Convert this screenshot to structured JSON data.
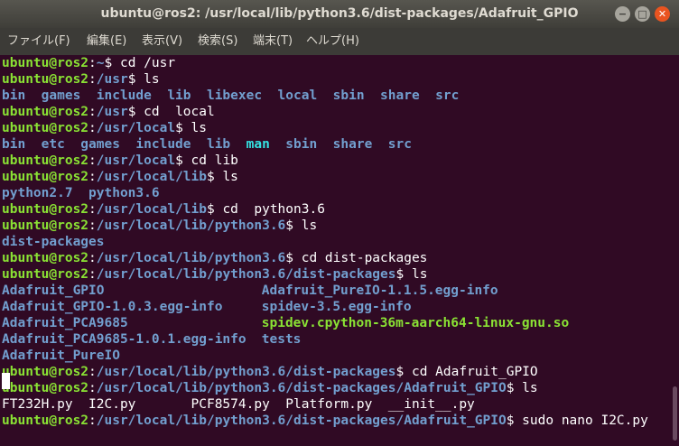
{
  "window": {
    "title": "ubuntu@ros2: /usr/local/lib/python3.6/dist-packages/Adafruit_GPIO",
    "minimize_glyph": "−",
    "maximize_glyph": "□",
    "close_glyph": "✕"
  },
  "menu": [
    "ファイル(F)",
    "編集(E)",
    "表示(V)",
    "検索(S)",
    "端末(T)",
    "ヘルプ(H)"
  ],
  "colors": {
    "background": "#300a24",
    "user_host": "#8ae234",
    "path": "#729fcf",
    "directory": "#729fcf",
    "symlink": "#34e2e2",
    "text": "#ffffff"
  },
  "terminal": {
    "lines": [
      {
        "segs": [
          {
            "t": "ubuntu@ros2",
            "c": "u"
          },
          {
            "t": ":",
            "c": "t"
          },
          {
            "t": "~",
            "c": "p"
          },
          {
            "t": "$ cd /usr",
            "c": "t"
          }
        ]
      },
      {
        "segs": [
          {
            "t": "ubuntu@ros2",
            "c": "u"
          },
          {
            "t": ":",
            "c": "t"
          },
          {
            "t": "/usr",
            "c": "p"
          },
          {
            "t": "$ ls",
            "c": "t"
          }
        ]
      },
      {
        "segs": [
          {
            "t": "bin  games  include  lib  libexec  local  sbin  share  src",
            "c": "d"
          }
        ]
      },
      {
        "segs": [
          {
            "t": "ubuntu@ros2",
            "c": "u"
          },
          {
            "t": ":",
            "c": "t"
          },
          {
            "t": "/usr",
            "c": "p"
          },
          {
            "t": "$ cd  local",
            "c": "t"
          }
        ]
      },
      {
        "segs": [
          {
            "t": "ubuntu@ros2",
            "c": "u"
          },
          {
            "t": ":",
            "c": "t"
          },
          {
            "t": "/usr/local",
            "c": "p"
          },
          {
            "t": "$ ls",
            "c": "t"
          }
        ]
      },
      {
        "segs": [
          {
            "t": "bin  etc  games  include  lib  ",
            "c": "d"
          },
          {
            "t": "man",
            "c": "l"
          },
          {
            "t": "  sbin  share  src",
            "c": "d"
          }
        ]
      },
      {
        "segs": [
          {
            "t": "ubuntu@ros2",
            "c": "u"
          },
          {
            "t": ":",
            "c": "t"
          },
          {
            "t": "/usr/local",
            "c": "p"
          },
          {
            "t": "$ cd lib",
            "c": "t"
          }
        ]
      },
      {
        "segs": [
          {
            "t": "ubuntu@ros2",
            "c": "u"
          },
          {
            "t": ":",
            "c": "t"
          },
          {
            "t": "/usr/local/lib",
            "c": "p"
          },
          {
            "t": "$ ls",
            "c": "t"
          }
        ]
      },
      {
        "segs": [
          {
            "t": "python2.7  python3.6",
            "c": "d"
          }
        ]
      },
      {
        "segs": [
          {
            "t": "ubuntu@ros2",
            "c": "u"
          },
          {
            "t": ":",
            "c": "t"
          },
          {
            "t": "/usr/local/lib",
            "c": "p"
          },
          {
            "t": "$ cd  python3.6",
            "c": "t"
          }
        ]
      },
      {
        "segs": [
          {
            "t": "ubuntu@ros2",
            "c": "u"
          },
          {
            "t": ":",
            "c": "t"
          },
          {
            "t": "/usr/local/lib/python3.6",
            "c": "p"
          },
          {
            "t": "$ ls",
            "c": "t"
          }
        ]
      },
      {
        "segs": [
          {
            "t": "dist-packages",
            "c": "d"
          }
        ]
      },
      {
        "segs": [
          {
            "t": "ubuntu@ros2",
            "c": "u"
          },
          {
            "t": ":",
            "c": "t"
          },
          {
            "t": "/usr/local/lib/python3.6",
            "c": "p"
          },
          {
            "t": "$ cd dist-packages",
            "c": "t"
          }
        ]
      },
      {
        "segs": [
          {
            "t": "ubuntu@ros2",
            "c": "u"
          },
          {
            "t": ":",
            "c": "t"
          },
          {
            "t": "/usr/local/lib/python3.6/dist-packages",
            "c": "p"
          },
          {
            "t": "$ ls",
            "c": "t"
          }
        ]
      },
      {
        "segs": [
          {
            "t": "Adafruit_GPIO",
            "c": "d",
            "w": 33
          },
          {
            "t": "Adafruit_PureIO-1.1.5.egg-info",
            "c": "d"
          }
        ]
      },
      {
        "segs": [
          {
            "t": "Adafruit_GPIO-1.0.3.egg-info",
            "c": "d",
            "w": 33
          },
          {
            "t": "spidev-3.5.egg-info",
            "c": "d"
          }
        ]
      },
      {
        "segs": [
          {
            "t": "Adafruit_PCA9685",
            "c": "d",
            "w": 33
          },
          {
            "t": "spidev.cpython-36m-aarch64-linux-gnu.so",
            "c": "g"
          }
        ]
      },
      {
        "segs": [
          {
            "t": "Adafruit_PCA9685-1.0.1.egg-info",
            "c": "d",
            "w": 33
          },
          {
            "t": "tests",
            "c": "d"
          }
        ]
      },
      {
        "segs": [
          {
            "t": "Adafruit_PureIO",
            "c": "d"
          }
        ]
      },
      {
        "segs": [
          {
            "t": "ubuntu@ros2",
            "c": "u"
          },
          {
            "t": ":",
            "c": "t"
          },
          {
            "t": "/usr/local/lib/python3.6/dist-packages",
            "c": "p"
          },
          {
            "t": "$ cd Adafruit_GPIO",
            "c": "t"
          }
        ]
      },
      {
        "segs": [
          {
            "t": "ubuntu@ros2",
            "c": "u"
          },
          {
            "t": ":",
            "c": "t"
          },
          {
            "t": "/usr/local/lib/python3.6/dist-packages/Adafruit_GPIO",
            "c": "p"
          },
          {
            "t": "$ ls",
            "c": "t"
          }
        ]
      },
      {
        "segs": [
          {
            "t": "FT232H.py  I2C.py       PCF8574.py  Platform.py  __init__.py",
            "c": "t"
          }
        ]
      },
      {
        "segs": [
          {
            "t": "ubuntu@ros2",
            "c": "u"
          },
          {
            "t": ":",
            "c": "t"
          },
          {
            "t": "/usr/local/lib/python3.6/dist-packages/Adafruit_GPIO",
            "c": "p"
          },
          {
            "t": "$ sudo nano I2C.py",
            "c": "t"
          }
        ]
      }
    ]
  }
}
